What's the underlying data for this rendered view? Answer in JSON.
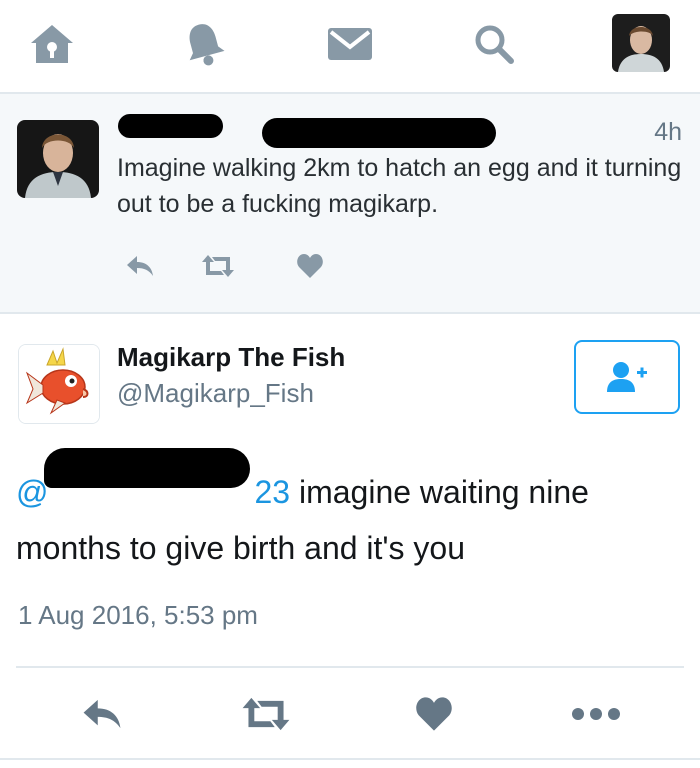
{
  "nav": {
    "icons": [
      "home-icon",
      "notifications-icon",
      "messages-icon",
      "search-icon",
      "profile-avatar"
    ]
  },
  "parent_tweet": {
    "time": "4h",
    "text": "Imagine walking 2km to hatch an egg and it turning out to be a fucking magikarp.",
    "actions": [
      "reply-icon",
      "retweet-icon",
      "like-icon"
    ]
  },
  "main_tweet": {
    "name": "Magikarp The Fish",
    "handle": "@Magikarp_Fish",
    "mention_visible_start": "@",
    "mention_visible_end": "23",
    "text_line1": " imagine waiting nine",
    "text_line2": "months to give birth and it's you",
    "timestamp": "1 Aug 2016, 5:53 pm",
    "actions": [
      "reply-icon",
      "retweet-icon",
      "like-icon",
      "more-icon"
    ]
  },
  "colors": {
    "accent": "#1da1f2",
    "icon_gray": "#8899a6",
    "icon_dark": "#657786",
    "text": "#14171a",
    "parent_bg": "#f5f8fa"
  }
}
